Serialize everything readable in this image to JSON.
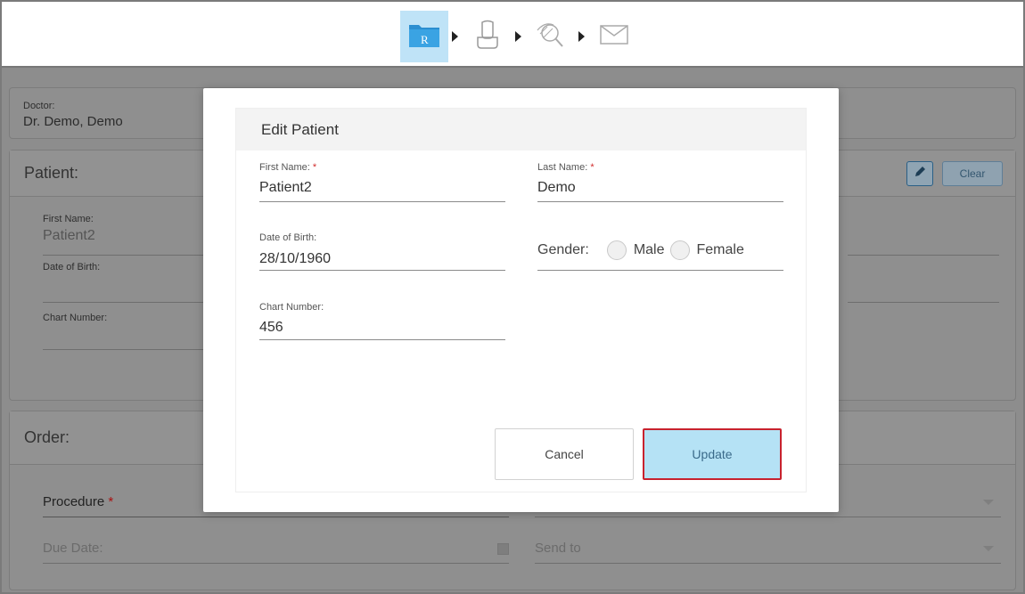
{
  "toolbar": {
    "steps": [
      {
        "icon": "rx-folder-icon",
        "active": true,
        "letter": "R"
      },
      {
        "icon": "scan-tooth-icon",
        "active": false
      },
      {
        "icon": "view-magnifier-icon",
        "active": false
      },
      {
        "icon": "send-envelope-icon",
        "active": false
      }
    ]
  },
  "background": {
    "doctor_label": "Doctor:",
    "doctor_value": "Dr. Demo, Demo",
    "patient_header": "Patient:",
    "clear_label": "Clear",
    "first_name_label": "First Name:",
    "first_name_value": "Patient2",
    "dob_label": "Date of Birth:",
    "chart_number_label": "Chart Number:",
    "order_header": "Order:",
    "procedure_label": "Procedure",
    "due_date_label": "Due Date:",
    "send_to_label": "Send to"
  },
  "modal": {
    "title": "Edit Patient",
    "first_name_label": "First Name:",
    "first_name_value": "Patient2",
    "last_name_label": "Last Name:",
    "last_name_value": "Demo",
    "dob_label": "Date of Birth:",
    "dob_value": "28/10/1960",
    "gender_label": "Gender:",
    "gender_male": "Male",
    "gender_female": "Female",
    "chart_number_label": "Chart Number:",
    "chart_number_value": "456",
    "required_mark": "*",
    "cancel_label": "Cancel",
    "update_label": "Update"
  },
  "colors": {
    "accent": "#b5e2f5",
    "highlight_border": "#c8222e",
    "required": "#d12c2c"
  }
}
